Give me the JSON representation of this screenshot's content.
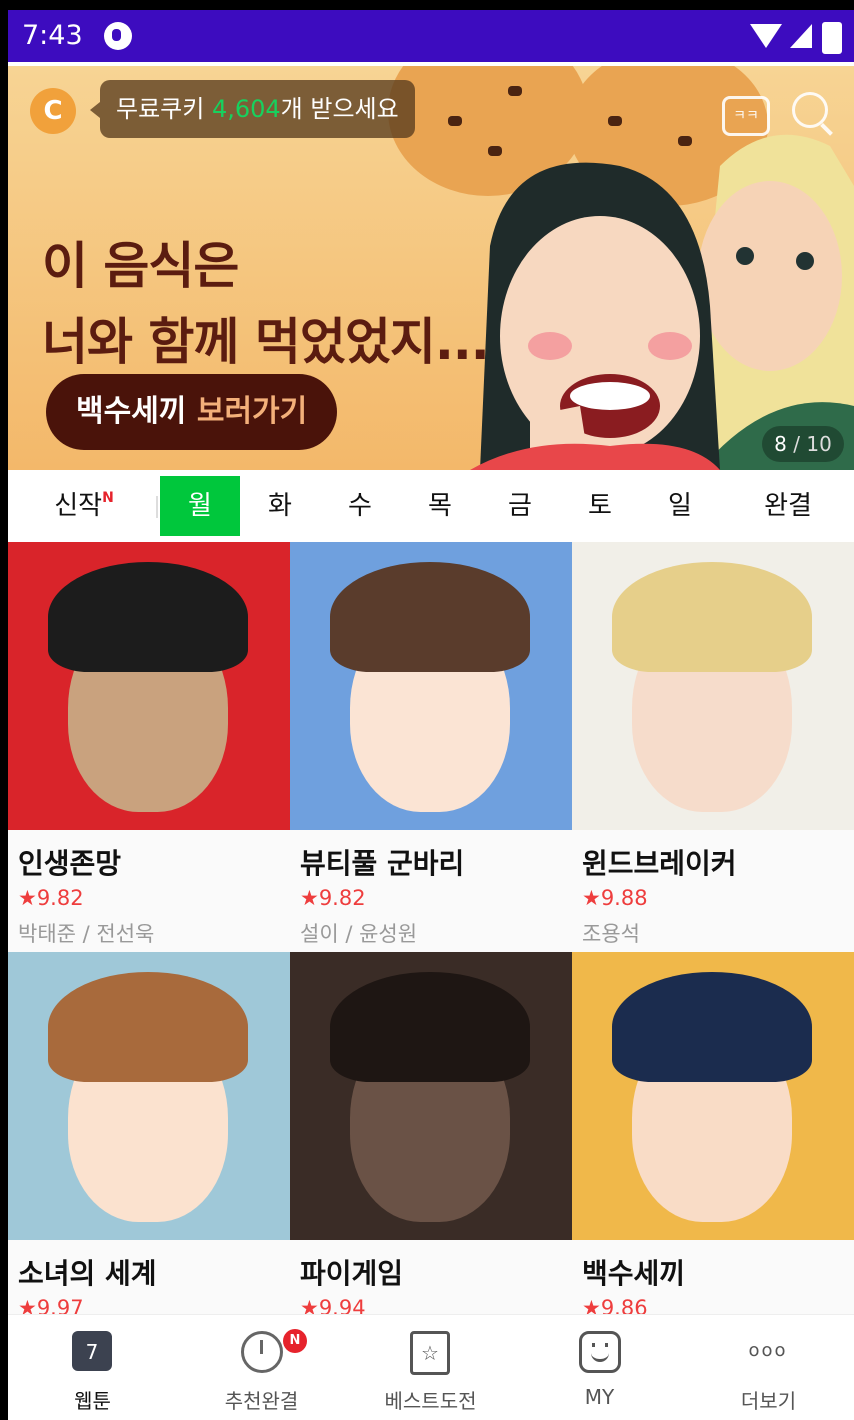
{
  "statusbar": {
    "time": "7:43"
  },
  "banner": {
    "cookie_prefix": "무료쿠키 ",
    "cookie_count": "4,604",
    "cookie_suffix": "개 받으세요",
    "coin_letter": "C",
    "chat_icon_text": "ㅋㅋ",
    "headline_line1": "이 음식은",
    "headline_line2": "너와 함께 먹었었지...",
    "cta_part1": "백수세끼 ",
    "cta_part2": "보러가기",
    "page_current": "8",
    "page_total": "/ 10",
    "accent_color": "#17d15e"
  },
  "tabs": [
    {
      "label": "신작",
      "badge": "N"
    },
    {
      "label": "월",
      "active": true
    },
    {
      "label": "화"
    },
    {
      "label": "수"
    },
    {
      "label": "목"
    },
    {
      "label": "금"
    },
    {
      "label": "토"
    },
    {
      "label": "일"
    },
    {
      "label": "완결"
    }
  ],
  "webtoons": [
    {
      "title": "인생존망",
      "rating": "★9.82",
      "author": "박태준 / 전선욱",
      "bg": "#d9242a"
    },
    {
      "title": "뷰티풀 군바리",
      "rating": "★9.82",
      "author": "설이 / 윤성원",
      "bg": "#6fa0de"
    },
    {
      "title": "윈드브레이커",
      "rating": "★9.88",
      "author": "조용석",
      "bg": "#f1efe8"
    },
    {
      "title": "소녀의 세계",
      "rating": "★9.97",
      "author": "",
      "bg": "#9fc8d8"
    },
    {
      "title": "파이게임",
      "rating": "★9.94",
      "author": "",
      "bg": "#3a2c26"
    },
    {
      "title": "백수세끼",
      "rating": "★9.86",
      "author": "",
      "bg": "#f0b84a"
    }
  ],
  "bottomnav": [
    {
      "label": "웹툰",
      "icon": "calendar-icon",
      "icon_text": "7",
      "active": true
    },
    {
      "label": "추천완결",
      "icon": "clock-icon",
      "badge": "N"
    },
    {
      "label": "베스트도전",
      "icon": "star-icon",
      "icon_text": "☆"
    },
    {
      "label": "MY",
      "icon": "smile-icon"
    },
    {
      "label": "더보기",
      "icon": "more-icon",
      "icon_text": "ooo"
    }
  ]
}
